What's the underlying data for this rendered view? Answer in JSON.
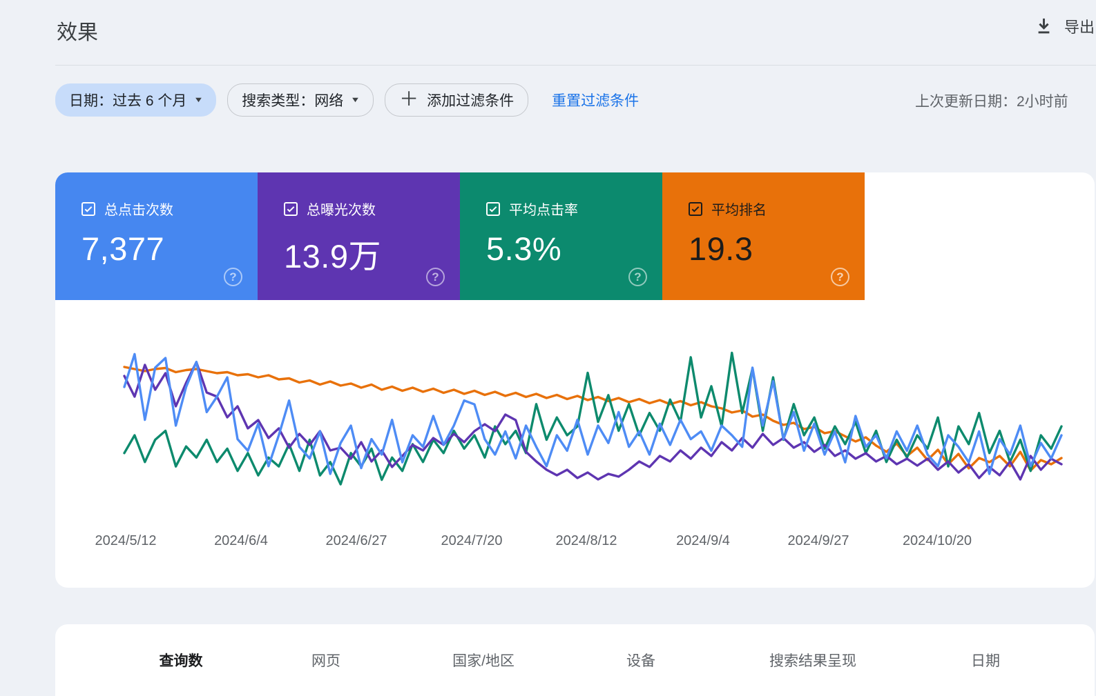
{
  "page": {
    "title": "效果",
    "export_label": "导出"
  },
  "icons": {
    "dropdown_arrow": "▼",
    "plus": "＋",
    "question": "?"
  },
  "filters": {
    "date_chip": "日期：过去 6 个月",
    "search_type_chip": "搜索类型：网络",
    "add_filter_chip": "添加过滤条件",
    "reset_link": "重置过滤条件",
    "last_updated": "上次更新日期：2小时前"
  },
  "metrics": {
    "cards": [
      {
        "label": "总点击次数",
        "value": "7,377",
        "color": "#4687f0",
        "text_color": "#ffffff",
        "checked": true
      },
      {
        "label": "总曝光次数",
        "value": "13.9万",
        "color": "#5e35b1",
        "text_color": "#ffffff",
        "checked": true
      },
      {
        "label": "平均点击率",
        "value": "5.3%",
        "color": "#0c8a6e",
        "text_color": "#ffffff",
        "checked": true
      },
      {
        "label": "平均排名",
        "value": "19.3",
        "color": "#e8710a",
        "text_color": "#1c1c1c",
        "checked": true
      }
    ]
  },
  "chart_data": {
    "type": "line",
    "title": "",
    "grid": false,
    "legend_position": "none",
    "x_tick_labels": [
      "2024/5/12",
      "2024/6/4",
      "2024/6/27",
      "2024/7/20",
      "2024/8/12",
      "2024/9/4",
      "2024/9/27",
      "2024/10/20"
    ],
    "x_tick_positions": [
      102,
      269,
      436,
      603,
      769,
      938,
      1105,
      1277
    ],
    "series": [
      {
        "name": "总点击次数",
        "metric": "clicks_per_day",
        "color": "#4e8cf5",
        "z": 4,
        "inverted": false,
        "scale_min": 20,
        "scale_max": 95,
        "values": [
          75,
          92,
          58,
          85,
          90,
          55,
          75,
          88,
          62,
          70,
          80,
          48,
          42,
          56,
          34,
          50,
          68,
          44,
          38,
          52,
          30,
          46,
          55,
          33,
          48,
          40,
          58,
          36,
          50,
          44,
          60,
          45,
          55,
          68,
          66,
          48,
          40,
          52,
          38,
          55,
          44,
          34,
          50,
          42,
          58,
          40,
          55,
          46,
          62,
          44,
          52,
          40,
          56,
          45,
          58,
          48,
          52,
          42,
          55,
          50,
          44,
          85,
          55,
          78,
          48,
          62,
          42,
          56,
          40,
          52,
          36,
          60,
          44,
          50,
          38,
          52,
          42,
          55,
          40,
          34,
          50,
          44,
          36,
          52,
          30,
          48,
          40,
          55,
          34,
          46,
          38,
          50
        ]
      },
      {
        "name": "总曝光次数",
        "metric": "impressions_per_day",
        "color": "#5e35b1",
        "z": 3,
        "inverted": false,
        "scale_min": 450,
        "scale_max": 1500,
        "values": [
          1300,
          1150,
          1380,
          1200,
          1320,
          1080,
          1250,
          1400,
          1180,
          1150,
          1000,
          1080,
          920,
          980,
          850,
          920,
          780,
          880,
          800,
          900,
          760,
          780,
          700,
          820,
          680,
          760,
          640,
          720,
          800,
          760,
          850,
          800,
          880,
          820,
          900,
          950,
          900,
          1020,
          980,
          750,
          680,
          620,
          580,
          620,
          560,
          600,
          550,
          590,
          570,
          620,
          680,
          640,
          720,
          680,
          760,
          700,
          780,
          720,
          820,
          760,
          850,
          780,
          880,
          800,
          850,
          780,
          820,
          750,
          800,
          720,
          760,
          700,
          740,
          680,
          720,
          660,
          700,
          650,
          700,
          620,
          680,
          600,
          660,
          560,
          640,
          580,
          680,
          550,
          720,
          620,
          700,
          660
        ]
      },
      {
        "name": "平均点击率",
        "metric": "ctr_percent",
        "color": "#0d8a6d",
        "z": 2,
        "inverted": false,
        "scale_min": 3.4,
        "scale_max": 9.9,
        "values": [
          5.2,
          6.0,
          4.8,
          5.8,
          6.2,
          4.6,
          5.5,
          5.0,
          5.8,
          4.8,
          5.4,
          4.4,
          5.2,
          4.2,
          5.0,
          4.6,
          5.6,
          4.4,
          5.8,
          4.2,
          4.8,
          3.8,
          5.2,
          4.6,
          5.4,
          4.0,
          5.0,
          4.4,
          5.6,
          4.8,
          5.8,
          5.2,
          6.2,
          5.4,
          6.0,
          5.0,
          6.4,
          5.6,
          6.2,
          5.2,
          7.4,
          5.8,
          6.8,
          6.0,
          6.4,
          8.8,
          6.6,
          7.8,
          6.2,
          7.4,
          6.0,
          7.0,
          6.2,
          7.6,
          6.6,
          9.5,
          6.8,
          8.2,
          6.4,
          9.7,
          7.0,
          9.0,
          6.2,
          8.6,
          5.8,
          7.4,
          6.0,
          6.8,
          5.4,
          6.4,
          5.6,
          6.6,
          5.2,
          6.2,
          4.8,
          5.8,
          5.0,
          6.0,
          5.4,
          6.8,
          4.6,
          6.4,
          5.6,
          7.0,
          5.2,
          6.2,
          4.8,
          5.8,
          4.4,
          6.0,
          5.4,
          6.4
        ]
      },
      {
        "name": "平均排名",
        "metric": "average_position",
        "color": "#e8710a",
        "z": 1,
        "inverted": true,
        "scale_min": 12,
        "scale_max": 26,
        "values": [
          13.8,
          14.0,
          14.2,
          14.0,
          13.9,
          14.3,
          14.1,
          14.0,
          14.2,
          14.4,
          14.3,
          14.6,
          14.5,
          14.8,
          14.6,
          15.0,
          14.9,
          15.3,
          15.1,
          15.5,
          15.2,
          15.6,
          15.4,
          15.8,
          15.5,
          16.0,
          15.7,
          16.1,
          15.8,
          16.2,
          15.9,
          16.3,
          16.0,
          16.4,
          16.1,
          16.5,
          16.2,
          16.6,
          16.3,
          16.7,
          16.4,
          16.8,
          16.5,
          16.9,
          16.6,
          17.0,
          16.7,
          17.1,
          16.8,
          17.2,
          16.9,
          17.3,
          17.0,
          17.4,
          17.1,
          17.5,
          17.2,
          17.6,
          17.8,
          18.2,
          18.0,
          18.6,
          18.4,
          19.0,
          19.4,
          19.2,
          19.8,
          19.6,
          20.2,
          20.0,
          20.5,
          21.0,
          20.6,
          21.4,
          22.0,
          21.2,
          22.4,
          21.6,
          22.8,
          21.8,
          23.2,
          22.2,
          23.6,
          22.6,
          23.0,
          22.4,
          23.4,
          22.0,
          23.8,
          22.8,
          23.2,
          22.6
        ]
      }
    ]
  },
  "tabs": {
    "items": [
      {
        "label": "查询数",
        "active": true
      },
      {
        "label": "网页",
        "active": false
      },
      {
        "label": "国家/地区",
        "active": false
      },
      {
        "label": "设备",
        "active": false
      },
      {
        "label": "搜索结果呈现",
        "active": false
      },
      {
        "label": "日期",
        "active": false
      }
    ]
  }
}
